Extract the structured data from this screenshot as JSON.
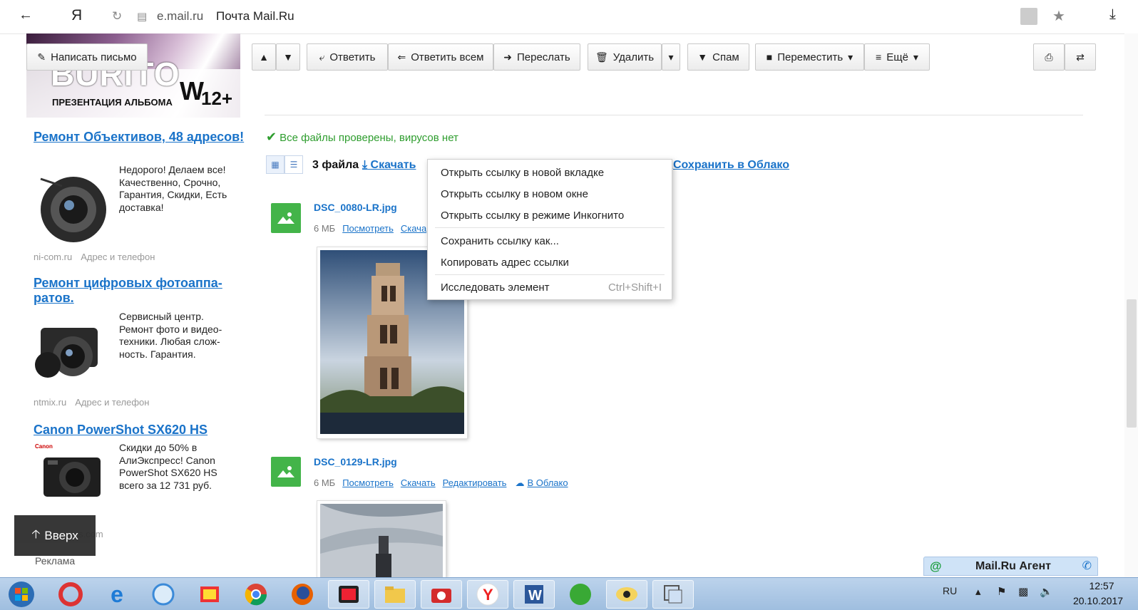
{
  "browser": {
    "url_domain": "e.mail.ru",
    "page_title": "Почта Mail.Ru",
    "yandex_label": "Я"
  },
  "toolbar": {
    "compose": "Написать письмо",
    "reply": "Ответить",
    "reply_all": "Ответить всем",
    "forward": "Переслать",
    "delete": "Удалить",
    "spam": "Спам",
    "move": "Переместить",
    "more": "Ещё"
  },
  "banner": {
    "big_text": "BURITO",
    "sub_text": "ПРЕЗЕНТАЦИЯ АЛЬБОМА",
    "age": "12+"
  },
  "ads": [
    {
      "title": "Ремонт Объективов, 48 адресов!",
      "text": "Недорого! Делаем все! Качественно, Срочно, Гарантия, Скидки, Есть доставка!",
      "domain": "ni-com.ru",
      "link": "Адрес и телефон"
    },
    {
      "title": "Ремонт цифровых фотоаппа-ратов.",
      "text": "Сервисный центр. Ремонт фото и видео-техники. Любая слож-ность. Гарантия.",
      "domain": "ntmix.ru",
      "link": "Адрес и телефон"
    },
    {
      "title": "Canon PowerShot SX620 HS",
      "text": "Скидки до 50% в АлиЭкспресс! Canon PowerShot SX620 HS всего за 12 731 руб.",
      "brand": "Canon",
      "domain_partial": "s.com"
    }
  ],
  "up_button": "Вверх",
  "ad_label": "Реклама",
  "attachments": {
    "virus_status": "Все файлы проверены, вирусов нет",
    "count": "3 файла",
    "download_partial": "Скачать",
    "save_cloud": "Сохранить в Облако",
    "files": [
      {
        "name": "DSC_0080-LR.jpg",
        "size": "6 МБ",
        "view": "Посмотреть",
        "download_partial": "Скача"
      },
      {
        "name": "DSC_0129-LR.jpg",
        "size": "6 МБ",
        "view": "Посмотреть",
        "download": "Скачать",
        "edit": "Редактировать",
        "cloud": "В Облако"
      }
    ]
  },
  "context_menu": {
    "items": [
      "Открыть ссылку в новой вкладке",
      "Открыть ссылку в новом окне",
      "Открыть ссылку в режиме Инкогнито",
      "Сохранить ссылку как...",
      "Копировать адрес ссылки",
      "Исследовать элемент"
    ],
    "inspect_shortcut": "Ctrl+Shift+I"
  },
  "agent": {
    "title": "Mail.Ru Агент"
  },
  "taskbar": {
    "language": "RU",
    "time": "12:57",
    "date": "20.10.2017"
  },
  "colors": {
    "link": "#1a73c9",
    "success": "#2e9d2e",
    "file_icon": "#43b449"
  }
}
